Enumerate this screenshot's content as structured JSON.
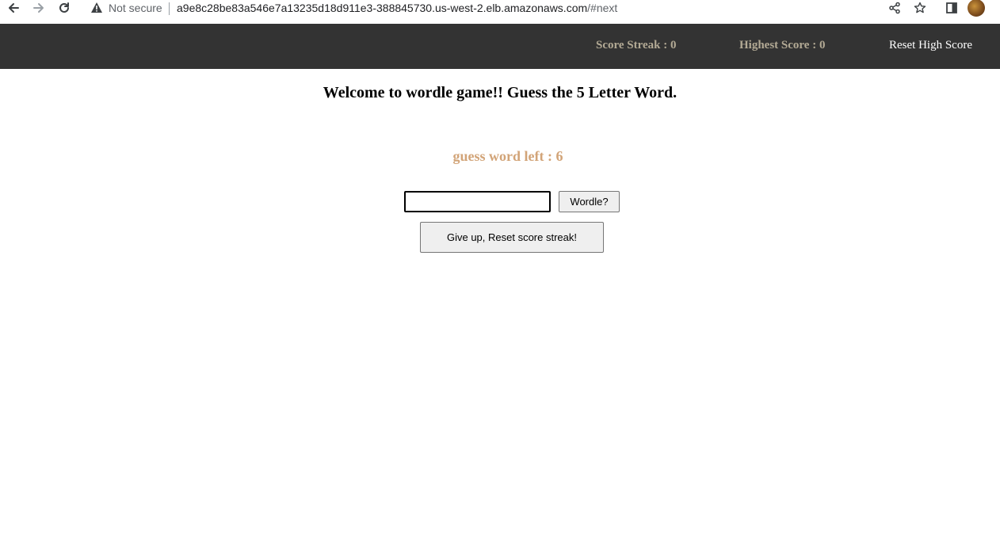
{
  "browser": {
    "security_label": "Not secure",
    "url_host": "a9e8c28be83a546e7a13235d18d911e3-388845730.us-west-2.elb.amazonaws.com",
    "url_fragment": "/#next",
    "icons": {
      "back": "back-arrow-icon",
      "forward": "forward-arrow-icon",
      "reload": "reload-icon",
      "warning": "warning-triangle-icon",
      "share": "share-icon",
      "bookmark": "star-icon",
      "side_panel": "side-panel-icon",
      "profile": "avatar"
    }
  },
  "header": {
    "score_streak": "Score Streak : 0",
    "highest_score": "Highest Score : 0",
    "reset_high_score": "Reset High Score"
  },
  "main": {
    "welcome": "Welcome to wordle game!! Guess the 5 Letter Word.",
    "guesses_left": "guess word left : 6",
    "input": {
      "value": "",
      "placeholder": ""
    },
    "submit_label": "Wordle?",
    "give_up_label": "Give up, Reset score streak!"
  },
  "colors": {
    "header_bg": "#333333",
    "header_stat": "#b3aa95",
    "guesses_left": "#d2a478"
  }
}
